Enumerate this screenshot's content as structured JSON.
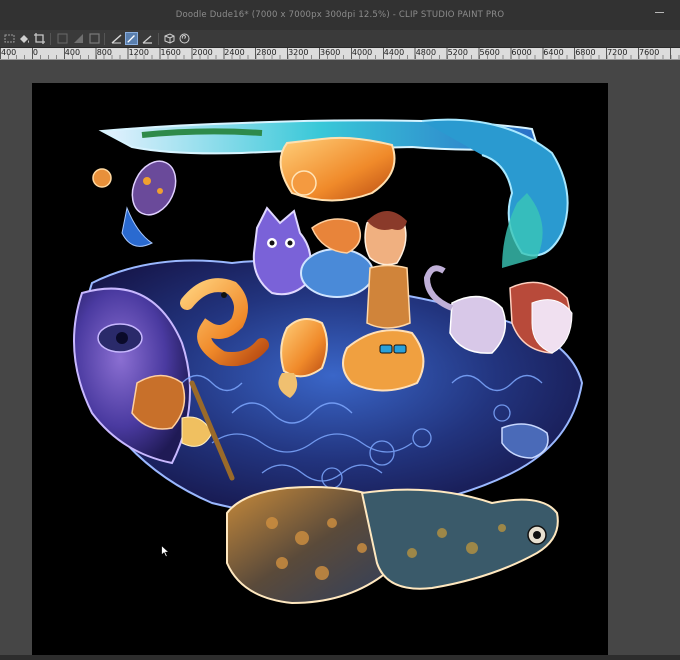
{
  "window": {
    "title": "Doodle Dude16* (7000 x 7000px 300dpi 12.5%)  - CLIP STUDIO PAINT PRO"
  },
  "toolbar": {
    "icons": [
      "rectangle-select-icon",
      "fill-icon",
      "crop-icon",
      "shape-icon",
      "gradient-icon",
      "frame-icon",
      "line-icon",
      "ruler-pen-icon",
      "angle-ruler-icon",
      "3d-icon",
      "spiral-icon"
    ],
    "active_icon": "ruler-pen-icon"
  },
  "ruler": {
    "labels": [
      "400",
      "0",
      "400",
      "800",
      "1200",
      "1600",
      "2000",
      "2400",
      "2800",
      "3200",
      "3600",
      "4000",
      "4400",
      "4800",
      "5200",
      "5600",
      "6000",
      "6400",
      "6800",
      "7200",
      "7600"
    ]
  },
  "canvas": {
    "background": "#000000",
    "artwork": "doodle-illustration"
  },
  "colors": {
    "titlebar": "#323232",
    "workspace": "#464646",
    "ruler": "#dcdcdc",
    "active_tool": "#5a7fae"
  }
}
